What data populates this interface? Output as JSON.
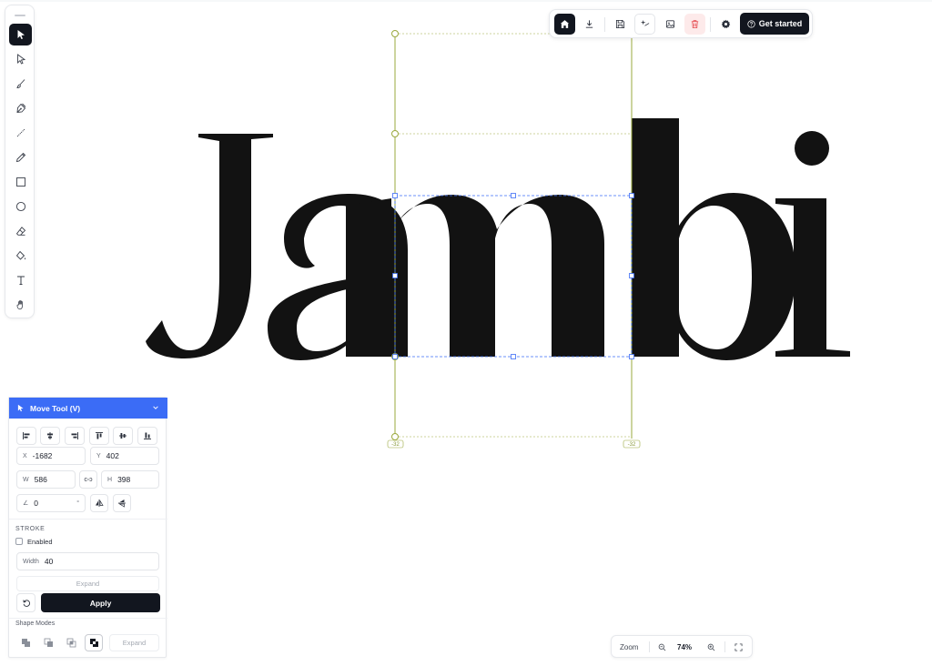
{
  "canvas": {
    "artwork_text": "Jambi",
    "dimension_badge_left": "-32",
    "dimension_badge_right": "-32",
    "colors": {
      "ink": "#121212",
      "guide": "#9aa83c",
      "selection": "#3b6cf6"
    }
  },
  "left_toolbar": {
    "tools": [
      {
        "name": "select-tool",
        "icon": "filled-arrow-icon",
        "active": true
      },
      {
        "name": "direct-select-tool",
        "icon": "outline-arrow-icon",
        "active": false
      },
      {
        "name": "brush-tool",
        "icon": "brush-icon",
        "active": false
      },
      {
        "name": "pen-tool",
        "icon": "pen-nib-icon",
        "active": false
      },
      {
        "name": "line-tool",
        "icon": "line-icon",
        "active": false
      },
      {
        "name": "pencil-tool",
        "icon": "pencil-icon",
        "active": false
      },
      {
        "name": "rectangle-tool",
        "icon": "square-icon",
        "active": false
      },
      {
        "name": "ellipse-tool",
        "icon": "circle-icon",
        "active": false
      },
      {
        "name": "eraser-tool",
        "icon": "eraser-icon",
        "active": false
      },
      {
        "name": "fill-tool",
        "icon": "paint-bucket-icon",
        "active": false
      },
      {
        "name": "text-tool",
        "icon": "text-icon",
        "active": false
      },
      {
        "name": "hand-tool",
        "icon": "hand-icon",
        "active": false
      }
    ]
  },
  "top_toolbar": {
    "buttons": [
      "home-icon",
      "download-icon",
      "save-icon",
      "magic-icon",
      "image-icon",
      "trash-icon",
      "gear-icon"
    ],
    "cta_label": "Get started"
  },
  "panel": {
    "title": "Move Tool (V)",
    "x_label": "X",
    "x_value": "-1682",
    "y_label": "Y",
    "y_value": "402",
    "w_label": "W",
    "w_value": "586",
    "h_label": "H",
    "h_value": "398",
    "angle_label": "∠",
    "angle_value": "0",
    "angle_unit": "°",
    "stroke_section": "STROKE",
    "stroke_enabled_label": "Enabled",
    "stroke_enabled": false,
    "width_label": "Width",
    "width_value": "40",
    "expand_label": "Expand",
    "apply_label": "Apply",
    "shape_modes_label": "Shape Modes",
    "shape_expand_label": "Expand"
  },
  "zoom": {
    "label": "Zoom",
    "value": "74%"
  }
}
